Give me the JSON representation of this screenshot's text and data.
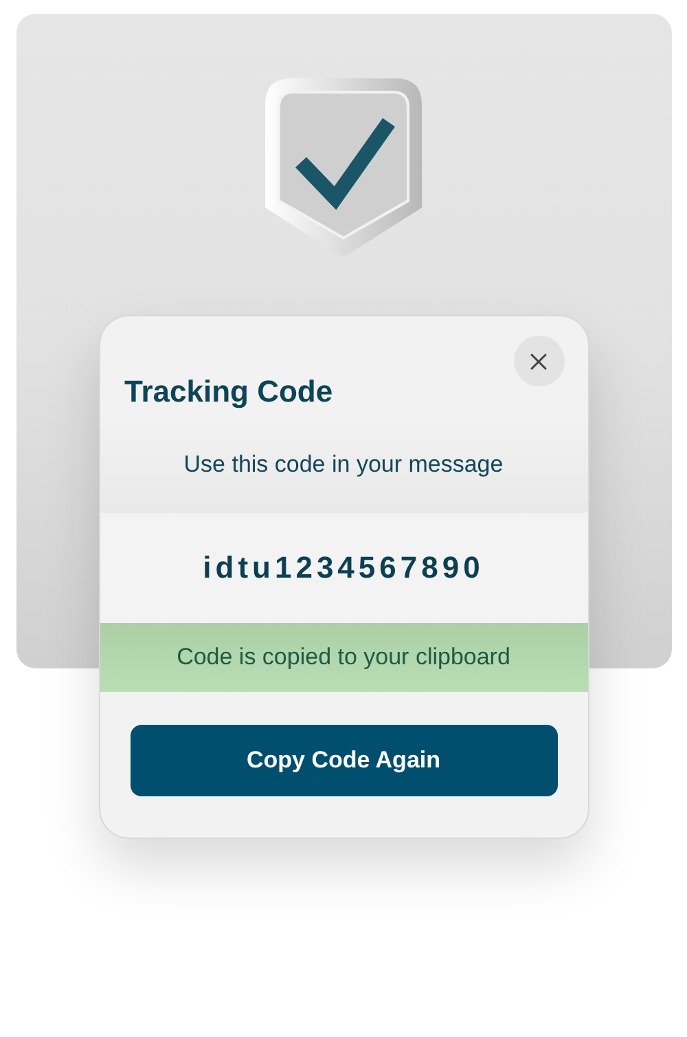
{
  "dialog": {
    "title": "Tracking Code",
    "subtitle": "Use this code in your message",
    "code": "idtu1234567890",
    "notice": "Code is copied to your clipboard",
    "button": "Copy Code Again"
  }
}
